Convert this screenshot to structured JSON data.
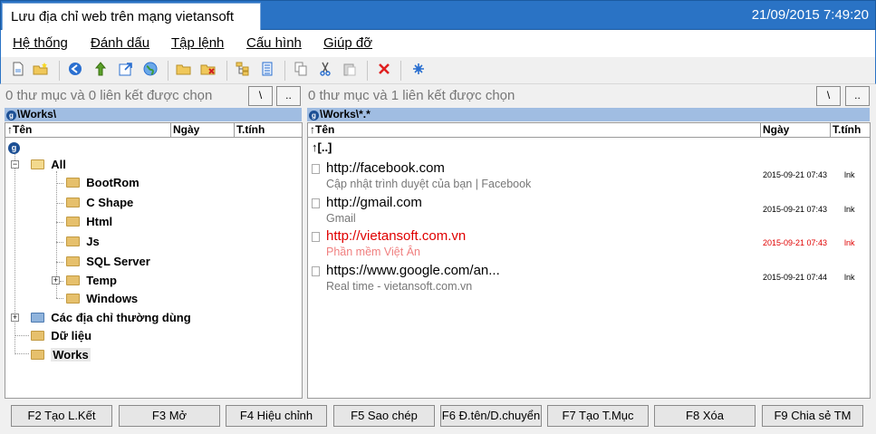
{
  "window": {
    "title": "Lưu địa chỉ web trên mạng vietansoft",
    "clock": "21/09/2015 7:49:20"
  },
  "menu": [
    "Hệ thống",
    "Đánh dấu",
    "Tập lệnh",
    "Cấu hình",
    "Giúp đỡ"
  ],
  "toolbar_icons": [
    "new-page-icon",
    "new-folder-icon",
    "back-icon",
    "up-icon",
    "open-external-icon",
    "globe-icon",
    "folder-open-icon",
    "folder-delete-icon",
    "tree-icon",
    "list-icon",
    "copy-icon",
    "cut-icon",
    "paste-icon",
    "delete-icon",
    "settings-icon"
  ],
  "left": {
    "status": "0 thư mục và 0 liên kết được chọn",
    "root_btn": "\\",
    "up_btn": "..",
    "path": "\\Works\\",
    "columns": {
      "name": "↑Tên",
      "date": "Ngày",
      "attr": "T.tính"
    },
    "tree": {
      "root_badge": "g",
      "all": "All",
      "children": [
        "BootRom",
        "C Shape",
        "Html",
        "Js",
        "SQL Server",
        "Temp",
        "Windows"
      ],
      "frequent": "Các địa chỉ thường dùng",
      "data": "Dữ liệu",
      "works": "Works"
    }
  },
  "right": {
    "status": "0 thư mục và 1 liên kết được chọn",
    "root_btn": "\\",
    "up_btn": "..",
    "path": "\\Works\\*.*",
    "columns": {
      "name": "↑Tên",
      "date": "Ngày",
      "attr": "T.tính"
    },
    "parent_entry": "↑[..]",
    "links": [
      {
        "url": "http://facebook.com",
        "desc": "Cập nhật trình duyệt của bạn | Facebook",
        "date": "2015-09-21 07:43",
        "attr": "lnk"
      },
      {
        "url": "http://gmail.com",
        "desc": "Gmail",
        "date": "2015-09-21 07:43",
        "attr": "lnk"
      },
      {
        "url": "http://vietansoft.com.vn",
        "desc": "Phần mềm Việt Ân",
        "date": "2015-09-21 07:43",
        "attr": "lnk"
      },
      {
        "url": "https://www.google.com/an...",
        "desc": "Real time - vietansoft.com.vn",
        "date": "2015-09-21 07:44",
        "attr": "lnk"
      }
    ]
  },
  "fkeys": [
    "F2 Tạo L.Kết",
    "F3 Mở",
    "F4 Hiệu chỉnh",
    "F5 Sao chép",
    "F6 Đ.tên/D.chuyển",
    "F7 Tạo T.Mục",
    "F8 Xóa",
    "F9 Chia sẻ TM"
  ],
  "colors": {
    "titlebar": "#2a73c5",
    "pathbar": "#a0bde2",
    "highlight": "#e00000"
  }
}
